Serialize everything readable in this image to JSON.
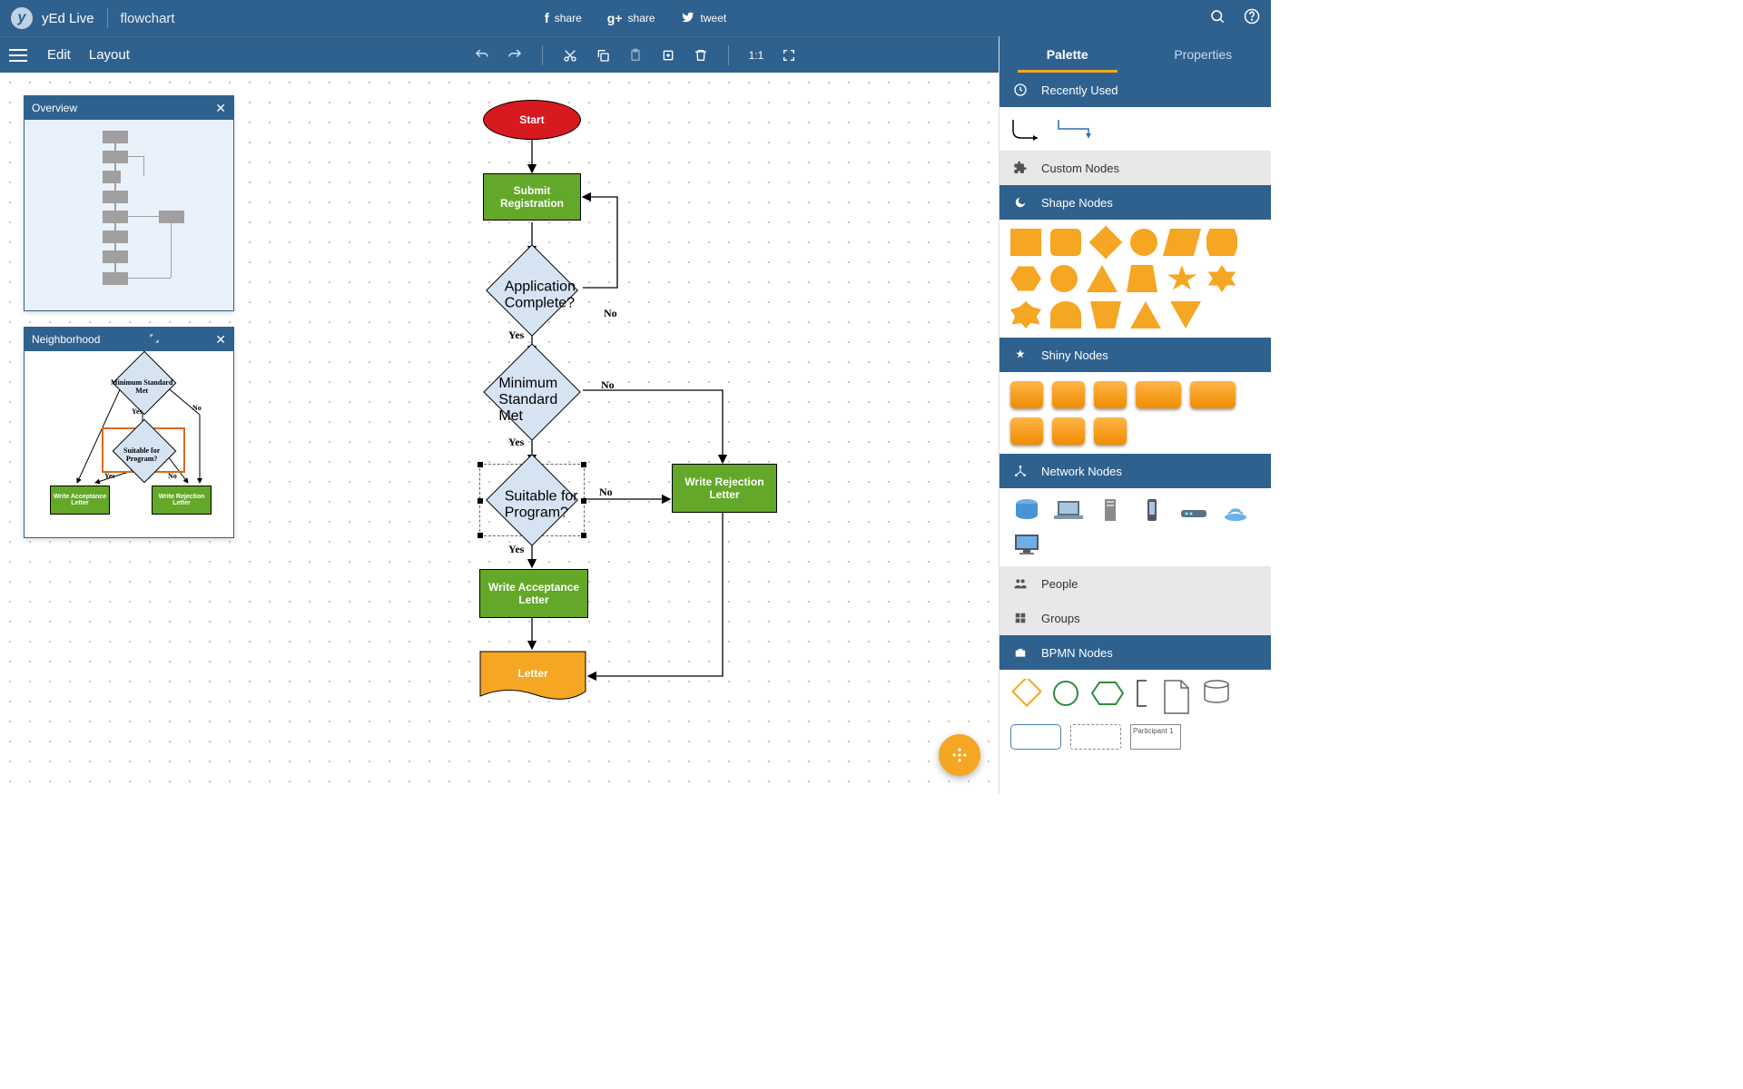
{
  "app": {
    "name": "yEd Live",
    "document": "flowchart"
  },
  "share": {
    "facebook": "share",
    "gplus": "share",
    "twitter": "tweet"
  },
  "menubar": {
    "edit": "Edit",
    "layout": "Layout",
    "ratio": "1:1"
  },
  "sidebar": {
    "tabs": {
      "palette": "Palette",
      "properties": "Properties"
    },
    "sections": {
      "recent": "Recently Used",
      "custom": "Custom Nodes",
      "shapes": "Shape Nodes",
      "shiny": "Shiny Nodes",
      "network": "Network Nodes",
      "people": "People",
      "groups": "Groups",
      "bpmn": "BPMN Nodes",
      "participant": "Participant 1"
    }
  },
  "panels": {
    "overview": "Overview",
    "neighborhood": "Neighborhood"
  },
  "flow": {
    "start": "Start",
    "submit": "Submit\nRegistration",
    "app_complete": "Application\nComplete?",
    "min_std": "Minimum\nStandard\nMet",
    "suitable": "Suitable for\nProgram?",
    "reject": "Write Rejection\nLetter",
    "accept": "Write Acceptance\nLetter",
    "letter": "Letter",
    "yes": "Yes",
    "no": "No"
  },
  "neighborhood": {
    "min_std": "Minimum\nStandard\nMet",
    "suitable": "Suitable for\nProgram?",
    "accept": "Write Acceptance\nLetter",
    "reject": "Write Rejection\nLetter",
    "yes": "Yes",
    "no": "No"
  }
}
